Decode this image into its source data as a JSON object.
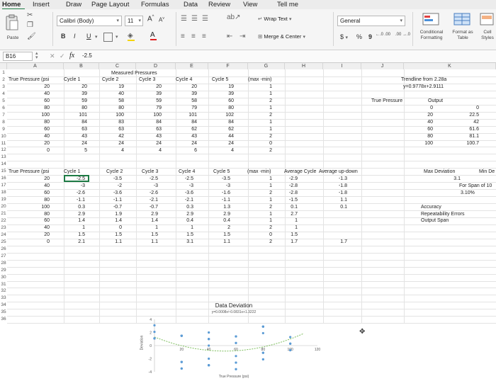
{
  "menu": {
    "items": [
      {
        "label": "Home",
        "x": 3
      },
      {
        "label": "Insert",
        "x": 46
      },
      {
        "label": "Draw",
        "x": 93
      },
      {
        "label": "Page Layout",
        "x": 129
      },
      {
        "label": "Formulas",
        "x": 199
      },
      {
        "label": "Data",
        "x": 259
      },
      {
        "label": "Review",
        "x": 294
      },
      {
        "label": "View",
        "x": 343
      },
      {
        "label": "Tell me",
        "x": 391
      }
    ]
  },
  "ribbon": {
    "paste_label": "Paste",
    "font_name": "Calibri (Body)",
    "font_size": "11",
    "grow_font": "A",
    "shrink_font": "A",
    "bold": "B",
    "italic": "I",
    "underline": "U",
    "wrap_text": "Wrap Text",
    "merge_center": "Merge & Center",
    "number_format": "General",
    "currency": "$",
    "percent": "%",
    "comma": "9",
    "inc_decimal": "←.0 .00",
    "dec_decimal": ".00 →.0",
    "conditional_formatting": "Conditional Formatting",
    "format_as_table": "Format as Table",
    "cell_styles": "Cell Styles"
  },
  "formula_bar": {
    "name_box": "B16",
    "fx": "fx",
    "value": "-2.5"
  },
  "columns": [
    {
      "label": "A",
      "x": 10,
      "w": 80
    },
    {
      "label": "B",
      "x": 90,
      "w": 50
    },
    {
      "label": "C",
      "x": 140,
      "w": 52
    },
    {
      "label": "D",
      "x": 192,
      "w": 56
    },
    {
      "label": "E",
      "x": 248,
      "w": 46
    },
    {
      "label": "F",
      "x": 294,
      "w": 56
    },
    {
      "label": "G",
      "x": 350,
      "w": 52
    },
    {
      "label": "H",
      "x": 402,
      "w": 54
    },
    {
      "label": "I",
      "x": 456,
      "w": 54
    },
    {
      "label": "J",
      "x": 510,
      "w": 60
    },
    {
      "label": "K",
      "x": 570,
      "w": 130
    }
  ],
  "rows": [
    "1",
    "2",
    "3",
    "4",
    "5",
    "6",
    "7",
    "8",
    "9",
    "10",
    "11",
    "12",
    "13",
    "14",
    "15",
    "16",
    "17",
    "18",
    "19",
    "20",
    "21",
    "22",
    "23",
    "24",
    "25",
    "26",
    "27",
    "28",
    "29",
    "30",
    "31",
    "32",
    "33",
    "34",
    "35",
    "36"
  ],
  "cells": [
    {
      "t": "Measured Pressures",
      "x": 157,
      "y": 1
    },
    {
      "t": "True Pressure (psi",
      "x": 12,
      "y": 2
    },
    {
      "t": "Cycle 1",
      "x": 90,
      "y": 2
    },
    {
      "t": "Cycle 2",
      "x": 144,
      "y": 2
    },
    {
      "t": "Cycle 3",
      "x": 196,
      "y": 2
    },
    {
      "t": "Cycle 4",
      "x": 248,
      "y": 2
    },
    {
      "t": "Cycle 5",
      "x": 299,
      "y": 2
    },
    {
      "t": "(max -min)",
      "x": 350,
      "y": 2
    },
    {
      "t": "20",
      "x": 70,
      "y": 3,
      "r": 1
    },
    {
      "t": "20",
      "x": 123,
      "y": 3,
      "r": 1
    },
    {
      "t": "19",
      "x": 175,
      "y": 3,
      "r": 1
    },
    {
      "t": "20",
      "x": 228,
      "y": 3,
      "r": 1
    },
    {
      "t": "20",
      "x": 278,
      "y": 3,
      "r": 1
    },
    {
      "t": "19",
      "x": 330,
      "y": 3,
      "r": 1
    },
    {
      "t": "1",
      "x": 384,
      "y": 3,
      "r": 1
    },
    {
      "t": "40",
      "x": 70,
      "y": 4,
      "r": 1
    },
    {
      "t": "39",
      "x": 123,
      "y": 4,
      "r": 1
    },
    {
      "t": "40",
      "x": 175,
      "y": 4,
      "r": 1
    },
    {
      "t": "39",
      "x": 228,
      "y": 4,
      "r": 1
    },
    {
      "t": "39",
      "x": 278,
      "y": 4,
      "r": 1
    },
    {
      "t": "39",
      "x": 330,
      "y": 4,
      "r": 1
    },
    {
      "t": "1",
      "x": 384,
      "y": 4,
      "r": 1
    },
    {
      "t": "60",
      "x": 70,
      "y": 5,
      "r": 1
    },
    {
      "t": "59",
      "x": 123,
      "y": 5,
      "r": 1
    },
    {
      "t": "58",
      "x": 175,
      "y": 5,
      "r": 1
    },
    {
      "t": "59",
      "x": 228,
      "y": 5,
      "r": 1
    },
    {
      "t": "58",
      "x": 278,
      "y": 5,
      "r": 1
    },
    {
      "t": "60",
      "x": 330,
      "y": 5,
      "r": 1
    },
    {
      "t": "2",
      "x": 384,
      "y": 5,
      "r": 1
    },
    {
      "t": "80",
      "x": 70,
      "y": 6,
      "r": 1
    },
    {
      "t": "80",
      "x": 123,
      "y": 6,
      "r": 1
    },
    {
      "t": "80",
      "x": 175,
      "y": 6,
      "r": 1
    },
    {
      "t": "79",
      "x": 228,
      "y": 6,
      "r": 1
    },
    {
      "t": "79",
      "x": 278,
      "y": 6,
      "r": 1
    },
    {
      "t": "80",
      "x": 330,
      "y": 6,
      "r": 1
    },
    {
      "t": "1",
      "x": 384,
      "y": 6,
      "r": 1
    },
    {
      "t": "100",
      "x": 70,
      "y": 7,
      "r": 1
    },
    {
      "t": "101",
      "x": 123,
      "y": 7,
      "r": 1
    },
    {
      "t": "100",
      "x": 175,
      "y": 7,
      "r": 1
    },
    {
      "t": "100",
      "x": 228,
      "y": 7,
      "r": 1
    },
    {
      "t": "101",
      "x": 278,
      "y": 7,
      "r": 1
    },
    {
      "t": "102",
      "x": 330,
      "y": 7,
      "r": 1
    },
    {
      "t": "2",
      "x": 384,
      "y": 7,
      "r": 1
    },
    {
      "t": "80",
      "x": 70,
      "y": 8,
      "r": 1
    },
    {
      "t": "84",
      "x": 123,
      "y": 8,
      "r": 1
    },
    {
      "t": "83",
      "x": 175,
      "y": 8,
      "r": 1
    },
    {
      "t": "84",
      "x": 228,
      "y": 8,
      "r": 1
    },
    {
      "t": "84",
      "x": 278,
      "y": 8,
      "r": 1
    },
    {
      "t": "84",
      "x": 330,
      "y": 8,
      "r": 1
    },
    {
      "t": "1",
      "x": 384,
      "y": 8,
      "r": 1
    },
    {
      "t": "60",
      "x": 70,
      "y": 9,
      "r": 1
    },
    {
      "t": "63",
      "x": 123,
      "y": 9,
      "r": 1
    },
    {
      "t": "63",
      "x": 175,
      "y": 9,
      "r": 1
    },
    {
      "t": "63",
      "x": 228,
      "y": 9,
      "r": 1
    },
    {
      "t": "62",
      "x": 278,
      "y": 9,
      "r": 1
    },
    {
      "t": "62",
      "x": 330,
      "y": 9,
      "r": 1
    },
    {
      "t": "1",
      "x": 384,
      "y": 9,
      "r": 1
    },
    {
      "t": "40",
      "x": 70,
      "y": 10,
      "r": 1
    },
    {
      "t": "43",
      "x": 123,
      "y": 10,
      "r": 1
    },
    {
      "t": "42",
      "x": 175,
      "y": 10,
      "r": 1
    },
    {
      "t": "43",
      "x": 228,
      "y": 10,
      "r": 1
    },
    {
      "t": "43",
      "x": 278,
      "y": 10,
      "r": 1
    },
    {
      "t": "44",
      "x": 330,
      "y": 10,
      "r": 1
    },
    {
      "t": "2",
      "x": 384,
      "y": 10,
      "r": 1
    },
    {
      "t": "20",
      "x": 70,
      "y": 11,
      "r": 1
    },
    {
      "t": "24",
      "x": 123,
      "y": 11,
      "r": 1
    },
    {
      "t": "24",
      "x": 175,
      "y": 11,
      "r": 1
    },
    {
      "t": "24",
      "x": 228,
      "y": 11,
      "r": 1
    },
    {
      "t": "24",
      "x": 278,
      "y": 11,
      "r": 1
    },
    {
      "t": "24",
      "x": 330,
      "y": 11,
      "r": 1
    },
    {
      "t": "0",
      "x": 384,
      "y": 11,
      "r": 1
    },
    {
      "t": "0",
      "x": 70,
      "y": 12,
      "r": 1
    },
    {
      "t": "5",
      "x": 123,
      "y": 12,
      "r": 1
    },
    {
      "t": "4",
      "x": 175,
      "y": 12,
      "r": 1
    },
    {
      "t": "4",
      "x": 228,
      "y": 12,
      "r": 1
    },
    {
      "t": "6",
      "x": 278,
      "y": 12,
      "r": 1
    },
    {
      "t": "4",
      "x": 330,
      "y": 12,
      "r": 1
    },
    {
      "t": "2",
      "x": 384,
      "y": 12,
      "r": 1
    },
    {
      "t": "Trendline from 2.28a",
      "x": 566,
      "y": 2
    },
    {
      "t": "y=0.9778x+2.9111",
      "x": 569,
      "y": 3
    },
    {
      "t": "True Pressure",
      "x": 524,
      "y": 5
    },
    {
      "t": "Output",
      "x": 604,
      "y": 5
    },
    {
      "t": "0",
      "x": 611,
      "y": 6,
      "r": 1
    },
    {
      "t": "0",
      "x": 676,
      "y": 6,
      "r": 1
    },
    {
      "t": "20",
      "x": 611,
      "y": 7,
      "r": 1
    },
    {
      "t": "22.5",
      "x": 676,
      "y": 7,
      "r": 1
    },
    {
      "t": "40",
      "x": 611,
      "y": 8,
      "r": 1
    },
    {
      "t": "42",
      "x": 676,
      "y": 8,
      "r": 1
    },
    {
      "t": "60",
      "x": 611,
      "y": 9,
      "r": 1
    },
    {
      "t": "61.6",
      "x": 676,
      "y": 9,
      "r": 1
    },
    {
      "t": "80",
      "x": 611,
      "y": 10,
      "r": 1
    },
    {
      "t": "81.1",
      "x": 676,
      "y": 10,
      "r": 1
    },
    {
      "t": "100",
      "x": 611,
      "y": 11,
      "r": 1
    },
    {
      "t": "100.7",
      "x": 676,
      "y": 11,
      "r": 1
    },
    {
      "t": "True Pressure (psi",
      "x": 12,
      "y": 15
    },
    {
      "t": "Cycle 1",
      "x": 90,
      "y": 15
    },
    {
      "t": "Cycle 2",
      "x": 150,
      "y": 15
    },
    {
      "t": "Cycle 3",
      "x": 200,
      "y": 15
    },
    {
      "t": "Cycle 4",
      "x": 252,
      "y": 15
    },
    {
      "t": "Cycle 5",
      "x": 301,
      "y": 15
    },
    {
      "t": "(max -min)",
      "x": 349,
      "y": 15
    },
    {
      "t": "Average Cycle",
      "x": 401,
      "y": 15
    },
    {
      "t": "Average up-down",
      "x": 450,
      "y": 15
    },
    {
      "t": "Max Deviation",
      "x": 598,
      "y": 15
    },
    {
      "t": "Min De",
      "x": 676,
      "y": 15
    },
    {
      "t": "20",
      "x": 70,
      "y": 16,
      "r": 1
    },
    {
      "t": "-2.5",
      "x": 120,
      "y": 16,
      "r": 1
    },
    {
      "t": "-3.5",
      "x": 172,
      "y": 16,
      "r": 1
    },
    {
      "t": "-2.5",
      "x": 223,
      "y": 16,
      "r": 1
    },
    {
      "t": "-2.5",
      "x": 273,
      "y": 16,
      "r": 1
    },
    {
      "t": "-3.5",
      "x": 325,
      "y": 16,
      "r": 1
    },
    {
      "t": "1",
      "x": 384,
      "y": 16,
      "r": 1
    },
    {
      "t": "-2.9",
      "x": 420,
      "y": 16,
      "r": 1
    },
    {
      "t": "-1.3",
      "x": 490,
      "y": 16,
      "r": 1
    },
    {
      "t": "3.1",
      "x": 650,
      "y": 16,
      "r": 1
    },
    {
      "t": "40",
      "x": 70,
      "y": 17,
      "r": 1
    },
    {
      "t": "-3",
      "x": 120,
      "y": 17,
      "r": 1
    },
    {
      "t": "-2",
      "x": 172,
      "y": 17,
      "r": 1
    },
    {
      "t": "-3",
      "x": 223,
      "y": 17,
      "r": 1
    },
    {
      "t": "-3",
      "x": 273,
      "y": 17,
      "r": 1
    },
    {
      "t": "-3",
      "x": 325,
      "y": 17,
      "r": 1
    },
    {
      "t": "1",
      "x": 384,
      "y": 17,
      "r": 1
    },
    {
      "t": "-2.8",
      "x": 420,
      "y": 17,
      "r": 1
    },
    {
      "t": "-1.8",
      "x": 490,
      "y": 17,
      "r": 1
    },
    {
      "t": "For Span of 10",
      "x": 648,
      "y": 17
    },
    {
      "t": "60",
      "x": 70,
      "y": 18,
      "r": 1
    },
    {
      "t": "-2.6",
      "x": 120,
      "y": 18,
      "r": 1
    },
    {
      "t": "-3.6",
      "x": 172,
      "y": 18,
      "r": 1
    },
    {
      "t": "-2.6",
      "x": 223,
      "y": 18,
      "r": 1
    },
    {
      "t": "-3.6",
      "x": 273,
      "y": 18,
      "r": 1
    },
    {
      "t": "-1.6",
      "x": 325,
      "y": 18,
      "r": 1
    },
    {
      "t": "2",
      "x": 384,
      "y": 18,
      "r": 1
    },
    {
      "t": "-2.8",
      "x": 420,
      "y": 18,
      "r": 1
    },
    {
      "t": "-1.8",
      "x": 490,
      "y": 18,
      "r": 1
    },
    {
      "t": "3.10%",
      "x": 650,
      "y": 18
    },
    {
      "t": "80",
      "x": 70,
      "y": 19,
      "r": 1
    },
    {
      "t": "-1.1",
      "x": 120,
      "y": 19,
      "r": 1
    },
    {
      "t": "-1.1",
      "x": 172,
      "y": 19,
      "r": 1
    },
    {
      "t": "-2.1",
      "x": 223,
      "y": 19,
      "r": 1
    },
    {
      "t": "-2.1",
      "x": 273,
      "y": 19,
      "r": 1
    },
    {
      "t": "-1.1",
      "x": 325,
      "y": 19,
      "r": 1
    },
    {
      "t": "1",
      "x": 384,
      "y": 19,
      "r": 1
    },
    {
      "t": "-1.5",
      "x": 420,
      "y": 19,
      "r": 1
    },
    {
      "t": "1.1",
      "x": 490,
      "y": 19,
      "r": 1
    },
    {
      "t": "100",
      "x": 70,
      "y": 20,
      "r": 1
    },
    {
      "t": "0.3",
      "x": 120,
      "y": 20,
      "r": 1
    },
    {
      "t": "-0.7",
      "x": 172,
      "y": 20,
      "r": 1
    },
    {
      "t": "-0.7",
      "x": 223,
      "y": 20,
      "r": 1
    },
    {
      "t": "0.3",
      "x": 273,
      "y": 20,
      "r": 1
    },
    {
      "t": "1.3",
      "x": 325,
      "y": 20,
      "r": 1
    },
    {
      "t": "2",
      "x": 384,
      "y": 20,
      "r": 1
    },
    {
      "t": "0.1",
      "x": 420,
      "y": 20,
      "r": 1
    },
    {
      "t": "0.1",
      "x": 490,
      "y": 20,
      "r": 1
    },
    {
      "t": "Accuracy",
      "x": 594,
      "y": 20
    },
    {
      "t": "80",
      "x": 70,
      "y": 21,
      "r": 1
    },
    {
      "t": "2.9",
      "x": 120,
      "y": 21,
      "r": 1
    },
    {
      "t": "1.9",
      "x": 172,
      "y": 21,
      "r": 1
    },
    {
      "t": "2.9",
      "x": 223,
      "y": 21,
      "r": 1
    },
    {
      "t": "2.9",
      "x": 273,
      "y": 21,
      "r": 1
    },
    {
      "t": "2.9",
      "x": 325,
      "y": 21,
      "r": 1
    },
    {
      "t": "1",
      "x": 384,
      "y": 21,
      "r": 1
    },
    {
      "t": "2.7",
      "x": 420,
      "y": 21,
      "r": 1
    },
    {
      "t": "Repeatability Errors",
      "x": 594,
      "y": 21
    },
    {
      "t": "60",
      "x": 70,
      "y": 22,
      "r": 1
    },
    {
      "t": "1.4",
      "x": 120,
      "y": 22,
      "r": 1
    },
    {
      "t": "1.4",
      "x": 172,
      "y": 22,
      "r": 1
    },
    {
      "t": "1.4",
      "x": 223,
      "y": 22,
      "r": 1
    },
    {
      "t": "0.4",
      "x": 273,
      "y": 22,
      "r": 1
    },
    {
      "t": "0.4",
      "x": 325,
      "y": 22,
      "r": 1
    },
    {
      "t": "1",
      "x": 384,
      "y": 22,
      "r": 1
    },
    {
      "t": "1",
      "x": 420,
      "y": 22,
      "r": 1
    },
    {
      "t": "Output Span",
      "x": 594,
      "y": 22
    },
    {
      "t": "40",
      "x": 70,
      "y": 23,
      "r": 1
    },
    {
      "t": "1",
      "x": 120,
      "y": 23,
      "r": 1
    },
    {
      "t": "0",
      "x": 172,
      "y": 23,
      "r": 1
    },
    {
      "t": "1",
      "x": 223,
      "y": 23,
      "r": 1
    },
    {
      "t": "1",
      "x": 273,
      "y": 23,
      "r": 1
    },
    {
      "t": "2",
      "x": 325,
      "y": 23,
      "r": 1
    },
    {
      "t": "2",
      "x": 384,
      "y": 23,
      "r": 1
    },
    {
      "t": "1",
      "x": 420,
      "y": 23,
      "r": 1
    },
    {
      "t": "20",
      "x": 70,
      "y": 24,
      "r": 1
    },
    {
      "t": "1.5",
      "x": 120,
      "y": 24,
      "r": 1
    },
    {
      "t": "1.5",
      "x": 172,
      "y": 24,
      "r": 1
    },
    {
      "t": "1.5",
      "x": 223,
      "y": 24,
      "r": 1
    },
    {
      "t": "1.5",
      "x": 273,
      "y": 24,
      "r": 1
    },
    {
      "t": "1.5",
      "x": 325,
      "y": 24,
      "r": 1
    },
    {
      "t": "0",
      "x": 384,
      "y": 24,
      "r": 1
    },
    {
      "t": "1.5",
      "x": 420,
      "y": 24,
      "r": 1
    },
    {
      "t": "0",
      "x": 70,
      "y": 25,
      "r": 1
    },
    {
      "t": "2.1",
      "x": 120,
      "y": 25,
      "r": 1
    },
    {
      "t": "1.1",
      "x": 172,
      "y": 25,
      "r": 1
    },
    {
      "t": "1.1",
      "x": 223,
      "y": 25,
      "r": 1
    },
    {
      "t": "3.1",
      "x": 273,
      "y": 25,
      "r": 1
    },
    {
      "t": "1.1",
      "x": 325,
      "y": 25,
      "r": 1
    },
    {
      "t": "2",
      "x": 384,
      "y": 25,
      "r": 1
    },
    {
      "t": "1.7",
      "x": 420,
      "y": 25,
      "r": 1
    },
    {
      "t": "1.7",
      "x": 490,
      "y": 25,
      "r": 1
    }
  ],
  "chart_data": {
    "type": "scatter",
    "title": "Data Deviation",
    "subtitle": "y=0.0008x²-0.0831x+1.3222",
    "xlabel": "True Pressure (psi)",
    "ylabel": "Deviation",
    "xlim": [
      0,
      120
    ],
    "ylim": [
      -4,
      4
    ],
    "x_ticks": [
      20,
      40,
      60,
      80,
      100,
      120
    ],
    "y_ticks": [
      4,
      2,
      0,
      -2,
      -4
    ],
    "series": [
      {
        "x": [
          20,
          40,
          60,
          80,
          100,
          80,
          60,
          40,
          20,
          0
        ],
        "y": [
          -2.5,
          -3,
          -2.6,
          -1.1,
          0.3,
          2.9,
          1.4,
          1,
          1.5,
          2.1
        ]
      },
      {
        "x": [
          20,
          40,
          60,
          80,
          100,
          80,
          60,
          40,
          20,
          0
        ],
        "y": [
          -3.5,
          -2,
          -3.6,
          -1.1,
          -0.7,
          1.9,
          1.4,
          0,
          1.5,
          1.1
        ]
      },
      {
        "x": [
          20,
          40,
          60,
          80,
          100,
          80,
          60,
          40,
          20,
          0
        ],
        "y": [
          -2.5,
          -3,
          -2.6,
          -2.1,
          -0.7,
          2.9,
          1.4,
          1,
          1.5,
          1.1
        ]
      },
      {
        "x": [
          20,
          40,
          60,
          80,
          100,
          80,
          60,
          40,
          20,
          0
        ],
        "y": [
          -2.5,
          -3,
          -3.6,
          -2.1,
          0.3,
          2.9,
          0.4,
          1,
          1.5,
          3.1
        ]
      },
      {
        "x": [
          20,
          40,
          60,
          80,
          100,
          80,
          60,
          40,
          20,
          0
        ],
        "y": [
          -3.5,
          -3,
          -1.6,
          -1.1,
          1.3,
          2.9,
          0.4,
          2,
          1.5,
          1.1
        ]
      }
    ],
    "grid": false,
    "colors": {
      "points": "#5b9bd5",
      "trend": "#7fbf5f"
    }
  },
  "colors": {
    "menu_accent": "#1e7b45",
    "selection": "#1e7b45"
  }
}
